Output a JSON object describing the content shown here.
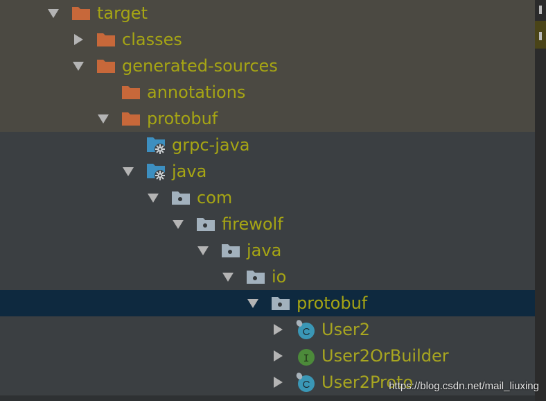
{
  "tree": [
    {
      "label": "target",
      "icon": "orange-folder-icon",
      "expanded": true,
      "depth": 0,
      "band": "excluded"
    },
    {
      "label": "classes",
      "icon": "orange-folder-icon",
      "expanded": false,
      "depth": 1,
      "band": "excluded"
    },
    {
      "label": "generated-sources",
      "icon": "orange-folder-icon",
      "expanded": true,
      "depth": 1,
      "band": "excluded"
    },
    {
      "label": "annotations",
      "icon": "orange-folder-icon",
      "arrow": "none",
      "depth": 2,
      "band": "excluded"
    },
    {
      "label": "protobuf",
      "icon": "orange-folder-icon",
      "expanded": true,
      "depth": 2,
      "band": "excluded"
    },
    {
      "label": "grpc-java",
      "icon": "generated-source-root-icon",
      "arrow": "none",
      "depth": 3,
      "band": "normal"
    },
    {
      "label": "java",
      "icon": "generated-source-root-icon",
      "expanded": true,
      "depth": 3,
      "band": "normal"
    },
    {
      "label": "com",
      "icon": "package-folder-icon",
      "expanded": true,
      "depth": 4,
      "band": "normal"
    },
    {
      "label": "firewolf",
      "icon": "package-folder-icon",
      "expanded": true,
      "depth": 5,
      "band": "normal"
    },
    {
      "label": "java",
      "icon": "package-folder-icon",
      "expanded": true,
      "depth": 6,
      "band": "normal"
    },
    {
      "label": "io",
      "icon": "package-folder-icon",
      "expanded": true,
      "depth": 7,
      "band": "normal"
    },
    {
      "label": "protobuf",
      "icon": "package-folder-icon",
      "expanded": true,
      "depth": 8,
      "band": "selected"
    },
    {
      "label": "User2",
      "icon": "java-class-icon",
      "expanded": false,
      "depth": 9,
      "band": "normal",
      "kind": "file"
    },
    {
      "label": "User2OrBuilder",
      "icon": "java-interface-icon",
      "expanded": false,
      "depth": 9,
      "band": "normal",
      "kind": "file"
    },
    {
      "label": "User2Proto",
      "icon": "java-class-icon",
      "expanded": false,
      "depth": 9,
      "band": "normal",
      "kind": "file"
    }
  ],
  "glyphs": {
    "class": "C",
    "interface": "I"
  },
  "colors": {
    "excluded_folder": "#c7683a",
    "package_folder": "#a2b1bd",
    "source_root": "#3d8fc0",
    "class_badge": "#3a97b6",
    "interface_badge": "#4c8a3a",
    "label_text": "#a6a514",
    "selection": "#0e293f"
  },
  "watermark": "https://blog.csdn.net/mail_liuxing"
}
